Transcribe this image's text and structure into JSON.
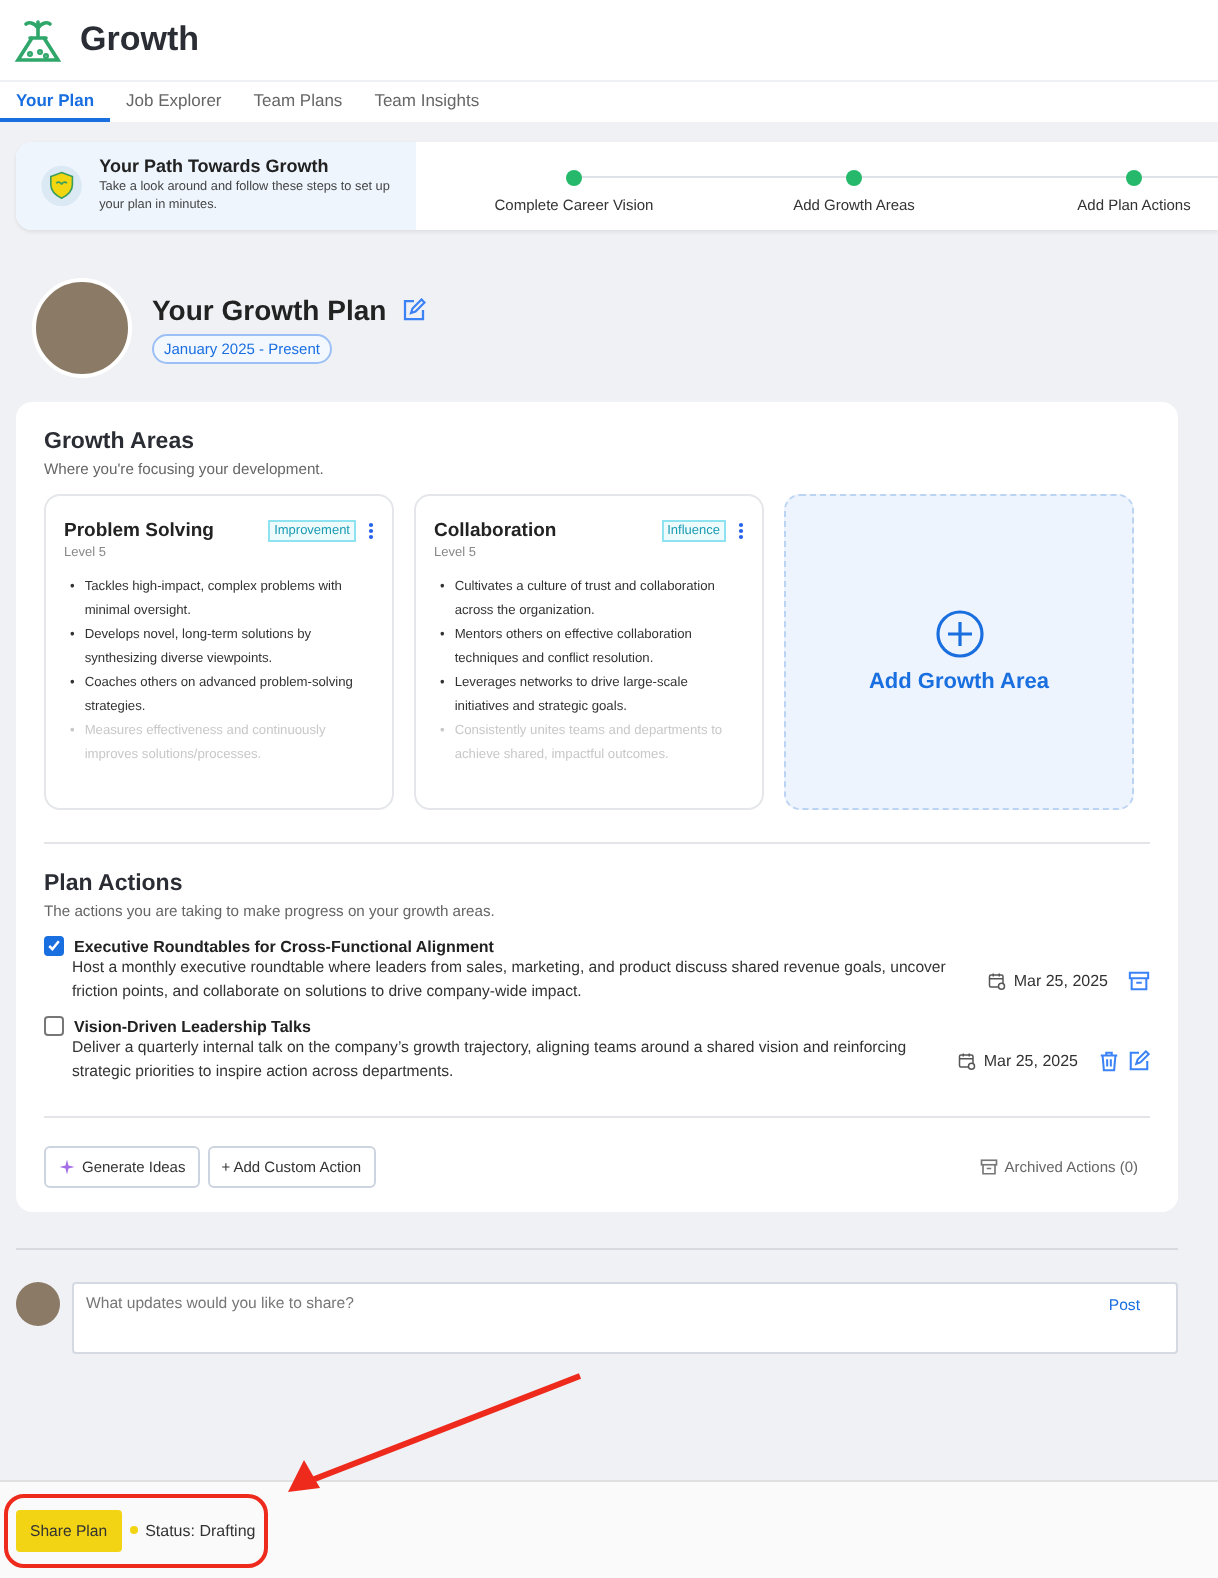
{
  "app": {
    "title": "Growth"
  },
  "tabs": [
    {
      "label": "Your Plan",
      "selected": true
    },
    {
      "label": "Job Explorer",
      "selected": false
    },
    {
      "label": "Team Plans",
      "selected": false
    },
    {
      "label": "Team Insights",
      "selected": false
    }
  ],
  "path_banner": {
    "title": "Your Path Towards Growth",
    "subtitle": "Take a look around and follow these steps to set up your plan in minutes.",
    "steps": [
      {
        "label": "Complete Career Vision",
        "done": true
      },
      {
        "label": "Add Growth Areas",
        "done": true
      },
      {
        "label": "Add Plan Actions",
        "done": true
      }
    ]
  },
  "plan": {
    "title": "Your Growth Plan",
    "period": "January 2025 - Present"
  },
  "growth_areas": {
    "title": "Growth Areas",
    "subtitle": "Where you're focusing your development.",
    "cards": [
      {
        "title": "Problem Solving",
        "tag": "Improvement",
        "level": "Level 5",
        "bullets": [
          {
            "marker": "•",
            "text": "Tackles high-impact, complex problems with minimal oversight.",
            "faded": false
          },
          {
            "marker": "•",
            "text": "Develops novel, long-term solutions by synthesizing diverse viewpoints.",
            "faded": false
          },
          {
            "marker": "•",
            "text": "Coaches others on advanced problem-solving strategies.",
            "faded": false
          },
          {
            "marker": "•",
            "text": "Measures effectiveness and continuously improves solutions/processes.",
            "faded": true
          }
        ]
      },
      {
        "title": "Collaboration",
        "tag": "Influence",
        "level": "Level 5",
        "bullets": [
          {
            "marker": "•",
            "text": "Cultivates a culture of trust and collaboration across the organization.",
            "faded": false
          },
          {
            "marker": "•",
            "text": "Mentors others on effective collaboration techniques and conflict resolution.",
            "faded": false
          },
          {
            "marker": "•",
            "text": "Leverages networks to drive large-scale initiatives and strategic goals.",
            "faded": false
          },
          {
            "marker": "•",
            "text": "Consistently unites teams and departments to achieve shared, impactful outcomes.",
            "faded": true
          }
        ]
      }
    ],
    "add_label": "Add Growth Area"
  },
  "plan_actions": {
    "title": "Plan Actions",
    "subtitle": "The actions you are taking to make progress on your growth areas.",
    "actions": [
      {
        "title": "Executive Roundtables for Cross-Functional Alignment",
        "description": "Host a monthly executive roundtable where leaders from sales, marketing, and product discuss shared revenue goals, uncover friction points, and collaborate on solutions to drive company-wide impact.",
        "date": "Mar 25, 2025",
        "checked": true
      },
      {
        "title": "Vision-Driven Leadership Talks",
        "description": "Deliver a quarterly internal talk on the company’s growth trajectory, aligning teams around a shared vision and reinforcing strategic priorities to inspire action across departments.",
        "date": "Mar 25, 2025",
        "checked": false
      }
    ],
    "buttons": [
      "Generate Ideas",
      "+ Add Custom Action"
    ],
    "archived": "Archived Actions (0)"
  },
  "comment": {
    "placeholder": "What updates would you like to share?",
    "post": "Post"
  },
  "footer": {
    "share": "Share Plan",
    "status": "Status: Drafting"
  }
}
